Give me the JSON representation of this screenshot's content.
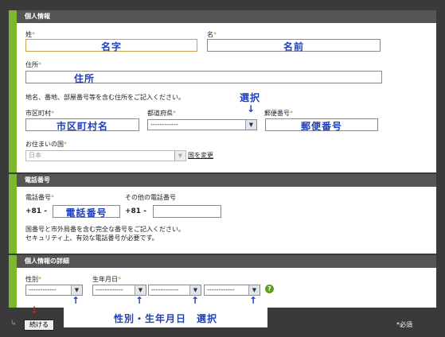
{
  "sections": {
    "personal": "個人情報",
    "phone": "電話番号",
    "details": "個人情報の詳細"
  },
  "labels": {
    "last_name": "姓",
    "first_name": "名",
    "address": "住所",
    "address_hint": "地名、番地、部屋番号等を含む住所をご記入ください。",
    "city": "市区町村",
    "prefecture": "都道府県",
    "postal": "郵便番号",
    "country": "お住まいの国",
    "phone_number": "電話番号",
    "other_phone": "その他の電話番号",
    "phone_hint_1": "国番号と市外局番を含む完全な番号をご記入ください。",
    "phone_hint_2": "セキュリティ上、有効な電話番号が必要です。",
    "gender": "性別",
    "birthdate": "生年月日",
    "required_mark": "*",
    "required_note": "*必須"
  },
  "annotations": {
    "last_name": "名字",
    "first_name": "名前",
    "address": "住所",
    "city": "市区町村名",
    "select": "選択",
    "select_arrow": "↓",
    "postal": "郵便番号",
    "phone": "電話番号",
    "gender_birth": "性別・生年月日　選択",
    "up_arrow": "↑",
    "down_arrow_red": "↓"
  },
  "selects": {
    "placeholder": "------------",
    "country_value": "日本",
    "arrow_glyph": "▼"
  },
  "phone": {
    "prefix": "+81 -",
    "prefix2": "+81 -"
  },
  "links": {
    "change_country": "国を変更"
  },
  "buttons": {
    "continue": "続ける",
    "help": "?"
  },
  "colors": {
    "accent_green": "#7cb82f",
    "annotation_blue": "#1e3fbf",
    "header_gray": "#555555"
  }
}
